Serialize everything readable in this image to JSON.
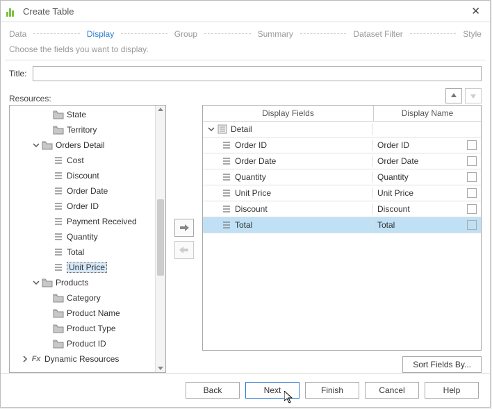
{
  "window": {
    "title": "Create Table"
  },
  "wizard": {
    "steps": [
      "Data",
      "Display",
      "Group",
      "Summary",
      "Dataset Filter",
      "Style"
    ],
    "active": 1,
    "subtitle": "Choose the fields you want to display."
  },
  "labels": {
    "title": "Title:",
    "resources": "Resources:",
    "displayFields": "Display Fields",
    "displayName": "Display Name",
    "sortFieldsBy": "Sort Fields By..."
  },
  "titleValue": "",
  "tree": {
    "items": [
      {
        "depth": 2,
        "kind": "folder",
        "label": "State"
      },
      {
        "depth": 2,
        "kind": "folder",
        "label": "Territory"
      },
      {
        "depth": 1,
        "kind": "folder",
        "label": "Orders Detail",
        "caret": "down"
      },
      {
        "depth": 2,
        "kind": "field",
        "label": "Cost"
      },
      {
        "depth": 2,
        "kind": "field",
        "label": "Discount"
      },
      {
        "depth": 2,
        "kind": "field",
        "label": "Order Date"
      },
      {
        "depth": 2,
        "kind": "field",
        "label": "Order ID"
      },
      {
        "depth": 2,
        "kind": "field",
        "label": "Payment Received"
      },
      {
        "depth": 2,
        "kind": "field",
        "label": "Quantity"
      },
      {
        "depth": 2,
        "kind": "field",
        "label": "Total"
      },
      {
        "depth": 2,
        "kind": "field",
        "label": "Unit Price",
        "selected": true
      },
      {
        "depth": 1,
        "kind": "folder",
        "label": "Products",
        "caret": "down"
      },
      {
        "depth": 2,
        "kind": "folder",
        "label": "Category"
      },
      {
        "depth": 2,
        "kind": "folder",
        "label": "Product Name"
      },
      {
        "depth": 2,
        "kind": "folder",
        "label": "Product Type"
      },
      {
        "depth": 2,
        "kind": "folder",
        "label": "Product ID"
      },
      {
        "depth": 0,
        "kind": "fx",
        "label": "Dynamic Resources",
        "caret": "right"
      }
    ]
  },
  "grid": {
    "detail": {
      "header": "Detail",
      "rows": [
        {
          "field": "Order ID",
          "name": "Order ID"
        },
        {
          "field": "Order Date",
          "name": "Order Date"
        },
        {
          "field": "Quantity",
          "name": "Quantity"
        },
        {
          "field": "Unit Price",
          "name": "Unit Price"
        },
        {
          "field": "Discount",
          "name": "Discount"
        },
        {
          "field": "Total",
          "name": "Total",
          "selected": true
        }
      ]
    }
  },
  "footer": {
    "back": "Back",
    "next": "Next",
    "finish": "Finish",
    "cancel": "Cancel",
    "help": "Help"
  }
}
